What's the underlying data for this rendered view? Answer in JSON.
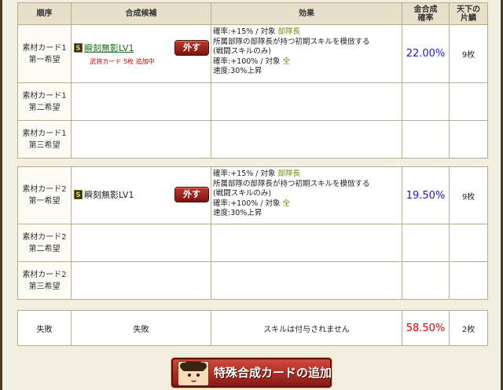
{
  "header": {
    "order": "順序",
    "candidate": "合成候補",
    "effect": "効果",
    "rate": "金合成\n確率",
    "pieces": "天下の\n片鱗"
  },
  "block1": {
    "rows": [
      {
        "label": "素材カード1\n第一希望",
        "skill_badge": "S",
        "skill_name": "瞬刻無影LV1",
        "remove_label": "外す",
        "note": "武将カード 5枚 追加中",
        "effect_line1_prefix": "確率:+15% / 対象 ",
        "effect_line1_target": "部隊長",
        "effect_line2": "所属部隊の部隊長が持つ初期スキルを模倣する",
        "effect_line3": "(戦闘スキルのみ)",
        "effect_line4_prefix": "確率:+100% / 対象 ",
        "effect_line4_target": "全",
        "effect_line5": "速度:30%上昇",
        "rate": "22.00%",
        "pieces": "9枚"
      },
      {
        "label": "素材カード1\n第二希望"
      },
      {
        "label": "素材カード1\n第三希望"
      }
    ]
  },
  "block2": {
    "rows": [
      {
        "label": "素材カード2\n第一希望",
        "skill_badge": "S",
        "skill_name": "瞬刻無影LV1",
        "remove_label": "外す",
        "effect_line1_prefix": "確率:+15% / 対象 ",
        "effect_line1_target": "部隊長",
        "effect_line2": "所属部隊の部隊長が持つ初期スキルを模倣する",
        "effect_line3": "(戦闘スキルのみ)",
        "effect_line4_prefix": "確率:+100% / 対象 ",
        "effect_line4_target": "全",
        "effect_line5": "速度:30%上昇",
        "rate": "19.50%",
        "pieces": "9枚"
      },
      {
        "label": "素材カード2\n第二希望"
      },
      {
        "label": "素材カード2\n第三希望"
      }
    ]
  },
  "failure": {
    "label": "失敗",
    "candidate": "失敗",
    "effect": "スキルは付与されません",
    "rate": "58.50%",
    "pieces": "2枚"
  },
  "add_button": {
    "label": "特殊合成カードの追加"
  },
  "colors": {
    "rate_blue": "#1a1acc",
    "rate_red": "#d10000",
    "target_green": "#6f8a00",
    "button_red": "#b02a20"
  }
}
